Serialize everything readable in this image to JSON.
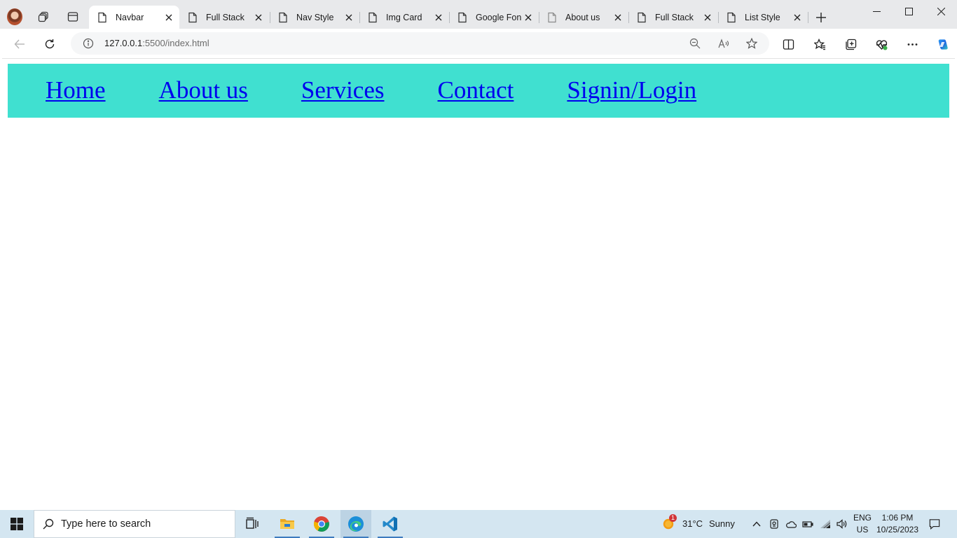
{
  "browser": {
    "tabs": [
      {
        "title": "Navbar",
        "active": true
      },
      {
        "title": "Full Stack",
        "active": false
      },
      {
        "title": "Nav Style",
        "active": false
      },
      {
        "title": "Img Card",
        "active": false
      },
      {
        "title": "Google Fon",
        "active": false
      },
      {
        "title": "About us",
        "active": false
      },
      {
        "title": "Full Stack",
        "active": false
      },
      {
        "title": "List Style",
        "active": false
      }
    ],
    "address": {
      "host": "127.0.0.1",
      "rest": ":5500/index.html"
    },
    "icons": {
      "profile": "profile-avatar",
      "workspaces": "workspaces-icon",
      "tab_actions": "tab-actions-icon",
      "page": "page-icon",
      "close": "close-icon",
      "new_tab": "plus-icon",
      "back": "back-arrow-icon",
      "refresh": "refresh-icon",
      "info": "info-icon",
      "zoom": "zoom-out-icon",
      "read_aloud": "read-aloud-icon",
      "favorite": "star-icon",
      "split": "split-screen-icon",
      "favorites": "favorites-icon",
      "collections": "collections-icon",
      "performance": "heartbeat-icon",
      "menu": "more-icon",
      "copilot": "copilot-icon"
    }
  },
  "page": {
    "nav_links": [
      "Home",
      "About us",
      "Services",
      "Contact",
      "Signin/Login"
    ],
    "navbar_color": "#40e0d0",
    "link_color": "#0000ee"
  },
  "taskbar": {
    "search_placeholder": "Type here to search",
    "weather": {
      "temp": "31°C",
      "condition": "Sunny",
      "badge": "1"
    },
    "language": {
      "line1": "ENG",
      "line2": "US"
    },
    "clock": {
      "time": "1:06 PM",
      "date": "10/25/2023"
    },
    "apps": [
      "task-view",
      "file-explorer",
      "chrome",
      "edge",
      "vscode"
    ]
  }
}
